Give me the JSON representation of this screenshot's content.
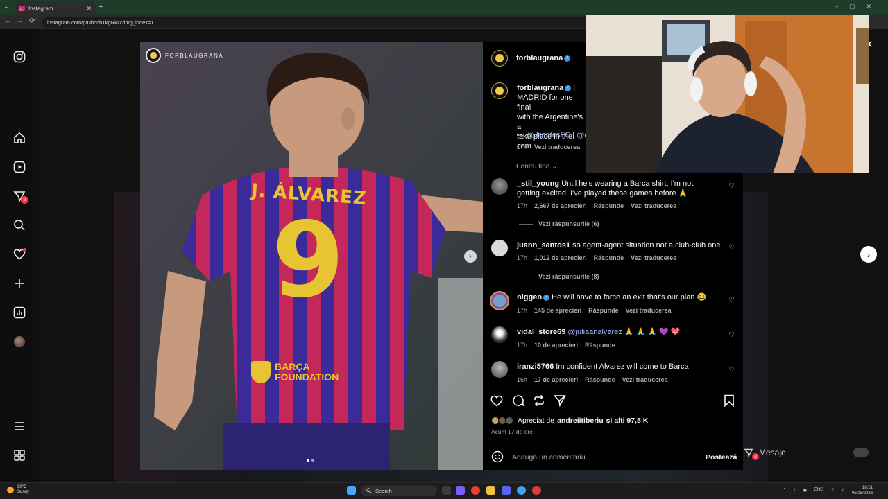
{
  "browser": {
    "tab_title": "Instagram",
    "url": "instagram.com/p/DbochTkgRkz/?img_index=1"
  },
  "post": {
    "brand_watermark": "FORBLAUGRANA",
    "author": "forblaugrana",
    "caption_lines": [
      "| ",
      "MADRID for one final",
      "with the Argentine's a",
      "take place in the com"
    ],
    "credit_prefix": "— ",
    "credit_mention_1": "@JijantesFC",
    "credit_separator": " | ",
    "credit_mention_2": "@di",
    "caption_time": "17h",
    "caption_translate": "Vezi traducerea",
    "for_you_label": "Pentru tine"
  },
  "comments": [
    {
      "user": "_stil_young",
      "text": "Until he's wearing a Barca shirt, I'm not getting excited. I've played these games before 🙏",
      "time": "17h",
      "likes": "2,667 de aprecieri",
      "reply": "Răspunde",
      "translate": "Vezi traducerea",
      "view_replies": "Vezi răspunsurile (6)"
    },
    {
      "user": "juann_santos1",
      "text": "so agent-agent situation not a club-club one",
      "time": "17h",
      "likes": "1,012 de aprecieri",
      "reply": "Răspunde",
      "translate": "Vezi traducerea",
      "view_replies": "Vezi răspunsurile (8)"
    },
    {
      "user": "niggeo",
      "text": "He will have to force an exit that's our plan 😂",
      "time": "17h",
      "likes": "145 de aprecieri",
      "reply": "Răspunde",
      "translate": "Vezi traducerea"
    },
    {
      "user": "vidal_store69",
      "mention": "@juliaanalvarez",
      "text": " 🙏 🙏 🙏 💜 💖",
      "time": "17h",
      "likes": "10 de aprecieri",
      "reply": "Răspunde"
    },
    {
      "user": "iranzi5766",
      "text": "Im confident Alvarez will come to Barca",
      "time": "16h",
      "likes": "17 de aprecieri",
      "reply": "Răspunde",
      "translate": "Vezi traducerea"
    }
  ],
  "likes_line": {
    "prefix": "Apreciat de ",
    "user": "andreiitiberiu",
    "suffix": " și alți 97,8 K"
  },
  "posted_ago": "Acum 17 de ore",
  "comment_input": {
    "placeholder": "Adaugă un comentariu...",
    "post_button": "Postează"
  },
  "messages_label": "Mesaje",
  "sidebar_badges": {
    "notifications": "2"
  },
  "messages_badge": "2",
  "taskbar": {
    "weather_temp": "30°C",
    "weather_desc": "Sunny",
    "search_label": "Search",
    "lang": "ENG",
    "time": "18:51",
    "date": "05/08/2026"
  },
  "colors": {
    "instagram_bg": "#000000",
    "verified": "#3897f0",
    "mention": "#a2b7ff",
    "tab_bar": "#1f3b2a"
  }
}
